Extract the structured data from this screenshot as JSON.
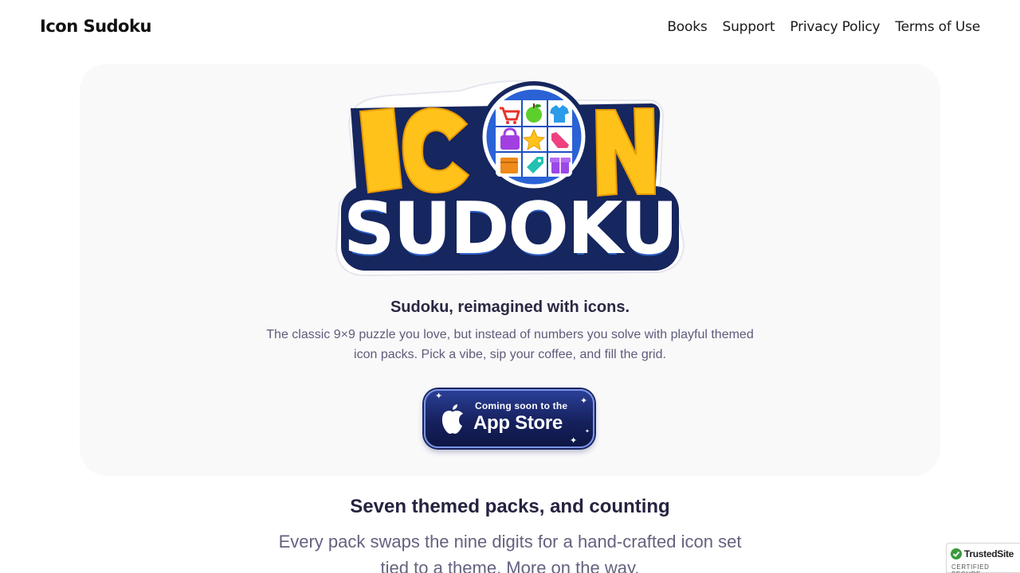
{
  "header": {
    "brand": "Icon Sudoku",
    "nav": [
      "Books",
      "Support",
      "Privacy Policy",
      "Terms of Use"
    ]
  },
  "hero": {
    "logo_alt": "ICON SUDOKU",
    "logo_word_top": "IC",
    "logo_word_top_end": "N",
    "logo_word_bottom": "SUDOKU",
    "logo_grid_icons": [
      "cart",
      "apple",
      "shirt",
      "bag",
      "star",
      "sneaker",
      "box",
      "tag",
      "gift"
    ],
    "tagline": "Sudoku, reimagined with icons.",
    "description": "The classic 9×9 puzzle you love, but instead of numbers you solve with playful themed icon packs. Pick a vibe, sip your coffee, and fill the grid.",
    "appstore": {
      "small": "Coming soon to the",
      "big": "App Store"
    }
  },
  "packs": {
    "title": "Seven themed packs, and counting",
    "description": "Every pack swaps the nine digits for a hand-crafted icon set tied to a theme. More on the way."
  },
  "badge": {
    "name": "TrustedSite",
    "sub": "CERTIFIED SECURE"
  },
  "colors": {
    "hero_bg": "#f9f9fa",
    "logo_yellow": "#ffc21a",
    "logo_navy": "#16265e",
    "button_navy": "#16215e"
  }
}
